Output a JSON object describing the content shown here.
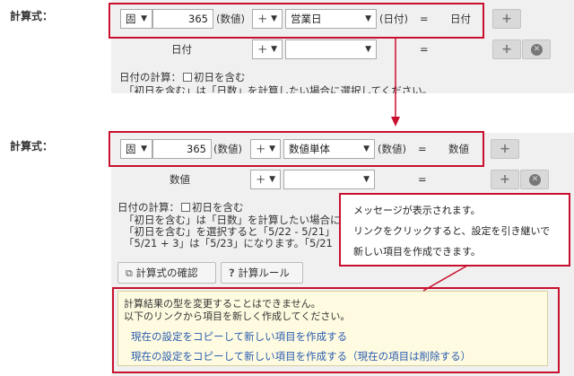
{
  "top": {
    "section_label": "計算式：",
    "row1": {
      "type_select": "固",
      "value": "365",
      "value_suffix": "(数値)",
      "operator": "＋",
      "field_select": "営業日",
      "field_suffix": "(日付)",
      "equals": "=",
      "result_type": "日付",
      "add_button": "+"
    },
    "row2": {
      "label": "日付",
      "operator": "＋",
      "field_select": "",
      "equals": "=",
      "add_button": "+"
    },
    "date_calc_label": "日付の計算：",
    "first_day_label": "初日を含む",
    "note_line": "「初日を含む」は「日数」を計算したい場合に選択してください。"
  },
  "bottom": {
    "section_label": "計算式：",
    "row1": {
      "type_select": "固",
      "value": "365",
      "value_suffix": "(数値)",
      "operator": "＋",
      "field_select": "数値単体",
      "field_suffix": "(数値)",
      "equals": "=",
      "result_type": "数値",
      "add_button": "+"
    },
    "row2": {
      "label": "数値",
      "operator": "＋",
      "field_select": "",
      "equals": "=",
      "add_button": "+"
    },
    "date_calc_label": "日付の計算：",
    "first_day_label": "初日を含む",
    "notes": [
      "「初日を含む」は「日数」を計算したい場合に選",
      "「初日を含む」を選択すると「5/22 - 5/21」",
      "「5/21 + 3」は「5/23」になります。「5/21"
    ],
    "confirm_button": "計算式の確認",
    "rule_button": "計算ルール",
    "warning": {
      "line1": "計算結果の型を変更することはできません。",
      "line2": "以下のリンクから項目を新しく作成してください。",
      "link1": "現在の設定をコピーして新しい項目を作成する",
      "link2": "現在の設定をコピーして新しい項目を作成する（現在の項目は削除する）"
    }
  },
  "callout": {
    "line1": "メッセージが表示されます。",
    "line2": "リンクをクリックすると、設定を引き継いで",
    "line3": "新しい項目を作成できます。"
  },
  "colors": {
    "highlight_red": "#c8102e",
    "link_blue": "#2a5db0",
    "warning_bg": "#fffbe0"
  }
}
